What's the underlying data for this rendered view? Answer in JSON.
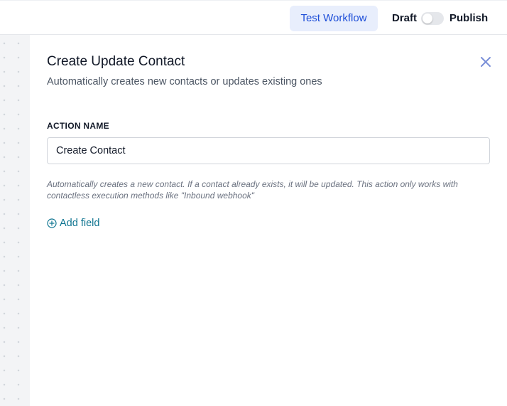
{
  "header": {
    "test_workflow_label": "Test Workflow",
    "draft_label": "Draft",
    "publish_label": "Publish",
    "publish_toggle_on": false
  },
  "panel": {
    "title": "Create Update Contact",
    "subtitle": "Automatically creates new contacts or updates existing ones",
    "close_icon": "close-icon",
    "action_name_label": "ACTION NAME",
    "action_name_value": "Create Contact",
    "helper_text": "Automatically creates a new contact. If a contact already exists, it will be updated. This action only works with contactless execution methods like \"Inbound webhook\"",
    "add_field_label": "Add field",
    "add_field_icon": "plus-circle-icon"
  },
  "colors": {
    "accent_blue": "#1d4ed8",
    "accent_blue_bg": "#e8eefc",
    "link_teal": "#0e7490",
    "close_icon": "#7b8fd8"
  }
}
